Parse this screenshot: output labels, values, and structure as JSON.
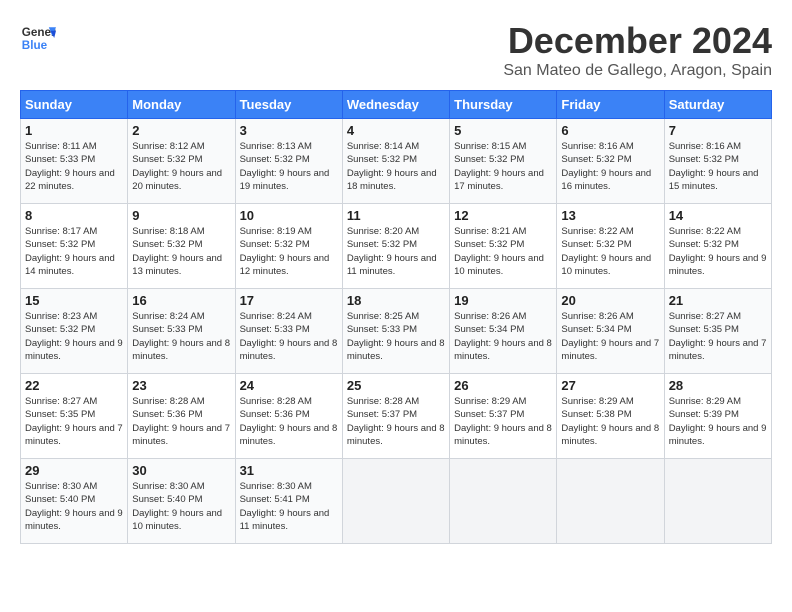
{
  "header": {
    "logo_line1": "General",
    "logo_line2": "Blue",
    "month_year": "December 2024",
    "location": "San Mateo de Gallego, Aragon, Spain"
  },
  "weekdays": [
    "Sunday",
    "Monday",
    "Tuesday",
    "Wednesday",
    "Thursday",
    "Friday",
    "Saturday"
  ],
  "weeks": [
    [
      {
        "day": "1",
        "sunrise": "8:11 AM",
        "sunset": "5:33 PM",
        "daylight": "9 hours and 22 minutes."
      },
      {
        "day": "2",
        "sunrise": "8:12 AM",
        "sunset": "5:32 PM",
        "daylight": "9 hours and 20 minutes."
      },
      {
        "day": "3",
        "sunrise": "8:13 AM",
        "sunset": "5:32 PM",
        "daylight": "9 hours and 19 minutes."
      },
      {
        "day": "4",
        "sunrise": "8:14 AM",
        "sunset": "5:32 PM",
        "daylight": "9 hours and 18 minutes."
      },
      {
        "day": "5",
        "sunrise": "8:15 AM",
        "sunset": "5:32 PM",
        "daylight": "9 hours and 17 minutes."
      },
      {
        "day": "6",
        "sunrise": "8:16 AM",
        "sunset": "5:32 PM",
        "daylight": "9 hours and 16 minutes."
      },
      {
        "day": "7",
        "sunrise": "8:16 AM",
        "sunset": "5:32 PM",
        "daylight": "9 hours and 15 minutes."
      }
    ],
    [
      {
        "day": "8",
        "sunrise": "8:17 AM",
        "sunset": "5:32 PM",
        "daylight": "9 hours and 14 minutes."
      },
      {
        "day": "9",
        "sunrise": "8:18 AM",
        "sunset": "5:32 PM",
        "daylight": "9 hours and 13 minutes."
      },
      {
        "day": "10",
        "sunrise": "8:19 AM",
        "sunset": "5:32 PM",
        "daylight": "9 hours and 12 minutes."
      },
      {
        "day": "11",
        "sunrise": "8:20 AM",
        "sunset": "5:32 PM",
        "daylight": "9 hours and 11 minutes."
      },
      {
        "day": "12",
        "sunrise": "8:21 AM",
        "sunset": "5:32 PM",
        "daylight": "9 hours and 10 minutes."
      },
      {
        "day": "13",
        "sunrise": "8:22 AM",
        "sunset": "5:32 PM",
        "daylight": "9 hours and 10 minutes."
      },
      {
        "day": "14",
        "sunrise": "8:22 AM",
        "sunset": "5:32 PM",
        "daylight": "9 hours and 9 minutes."
      }
    ],
    [
      {
        "day": "15",
        "sunrise": "8:23 AM",
        "sunset": "5:32 PM",
        "daylight": "9 hours and 9 minutes."
      },
      {
        "day": "16",
        "sunrise": "8:24 AM",
        "sunset": "5:33 PM",
        "daylight": "9 hours and 8 minutes."
      },
      {
        "day": "17",
        "sunrise": "8:24 AM",
        "sunset": "5:33 PM",
        "daylight": "9 hours and 8 minutes."
      },
      {
        "day": "18",
        "sunrise": "8:25 AM",
        "sunset": "5:33 PM",
        "daylight": "9 hours and 8 minutes."
      },
      {
        "day": "19",
        "sunrise": "8:26 AM",
        "sunset": "5:34 PM",
        "daylight": "9 hours and 8 minutes."
      },
      {
        "day": "20",
        "sunrise": "8:26 AM",
        "sunset": "5:34 PM",
        "daylight": "9 hours and 7 minutes."
      },
      {
        "day": "21",
        "sunrise": "8:27 AM",
        "sunset": "5:35 PM",
        "daylight": "9 hours and 7 minutes."
      }
    ],
    [
      {
        "day": "22",
        "sunrise": "8:27 AM",
        "sunset": "5:35 PM",
        "daylight": "9 hours and 7 minutes."
      },
      {
        "day": "23",
        "sunrise": "8:28 AM",
        "sunset": "5:36 PM",
        "daylight": "9 hours and 7 minutes."
      },
      {
        "day": "24",
        "sunrise": "8:28 AM",
        "sunset": "5:36 PM",
        "daylight": "9 hours and 8 minutes."
      },
      {
        "day": "25",
        "sunrise": "8:28 AM",
        "sunset": "5:37 PM",
        "daylight": "9 hours and 8 minutes."
      },
      {
        "day": "26",
        "sunrise": "8:29 AM",
        "sunset": "5:37 PM",
        "daylight": "9 hours and 8 minutes."
      },
      {
        "day": "27",
        "sunrise": "8:29 AM",
        "sunset": "5:38 PM",
        "daylight": "9 hours and 8 minutes."
      },
      {
        "day": "28",
        "sunrise": "8:29 AM",
        "sunset": "5:39 PM",
        "daylight": "9 hours and 9 minutes."
      }
    ],
    [
      {
        "day": "29",
        "sunrise": "8:30 AM",
        "sunset": "5:40 PM",
        "daylight": "9 hours and 9 minutes."
      },
      {
        "day": "30",
        "sunrise": "8:30 AM",
        "sunset": "5:40 PM",
        "daylight": "9 hours and 10 minutes."
      },
      {
        "day": "31",
        "sunrise": "8:30 AM",
        "sunset": "5:41 PM",
        "daylight": "9 hours and 11 minutes."
      },
      null,
      null,
      null,
      null
    ]
  ],
  "labels": {
    "sunrise": "Sunrise:",
    "sunset": "Sunset:",
    "daylight": "Daylight:"
  }
}
